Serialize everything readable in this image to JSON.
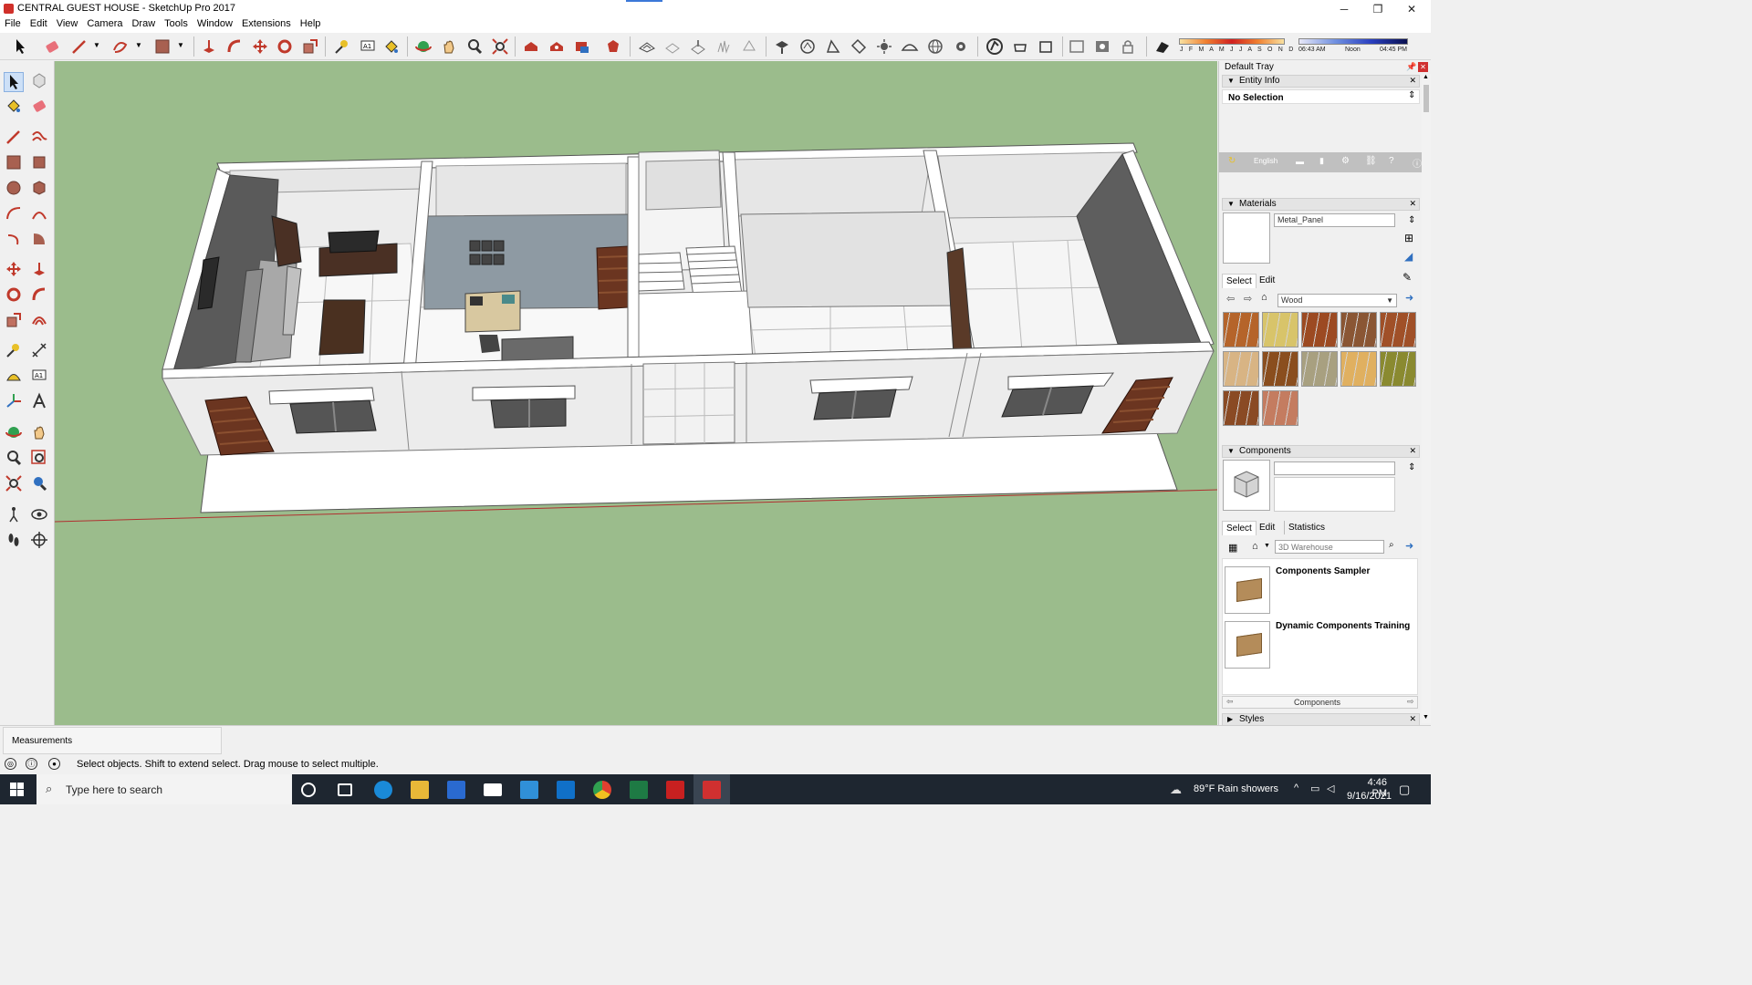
{
  "window": {
    "title": "CENTRAL GUEST HOUSE - SketchUp Pro 2017",
    "min_symbol": "─",
    "max_symbol": "❐",
    "close_symbol": "✕"
  },
  "menu": [
    "File",
    "Edit",
    "View",
    "Camera",
    "Draw",
    "Tools",
    "Window",
    "Extensions",
    "Help"
  ],
  "shadow": {
    "months": "J F M A M J J A S O N D",
    "time_start": "06:43 AM",
    "time_noon": "Noon",
    "time_end": "04:45 PM"
  },
  "tray": {
    "title": "Default Tray",
    "entity_info": {
      "header": "Entity Info",
      "selection": "No Selection"
    },
    "language": "English",
    "materials": {
      "header": "Materials",
      "current_name": "Metal_Panel",
      "tab_select": "Select",
      "tab_edit": "Edit",
      "collection": "Wood",
      "swatch_colors": [
        "#b5642a",
        "#d8c46a",
        "#9c4a22",
        "#8a5634",
        "#a05028",
        "#d8b484",
        "#8a4e1e",
        "#a8a080",
        "#e0b060",
        "#8a8a30",
        "#8a4a24",
        "#c47c60"
      ]
    },
    "components": {
      "header": "Components",
      "tab_select": "Select",
      "tab_edit": "Edit",
      "tab_statistics": "Statistics",
      "search_placeholder": "3D Warehouse",
      "items": [
        "Components Sampler",
        "Dynamic Components Training"
      ],
      "footer": "Components"
    },
    "styles": {
      "header": "Styles"
    }
  },
  "measurements": {
    "label": "Measurements"
  },
  "status": {
    "text": "Select objects. Shift to extend select. Drag mouse to select multiple."
  },
  "taskbar": {
    "search_placeholder": "Type here to search",
    "weather": "89°F  Rain showers",
    "time": "4:46 PM",
    "date": "9/16/2021"
  }
}
